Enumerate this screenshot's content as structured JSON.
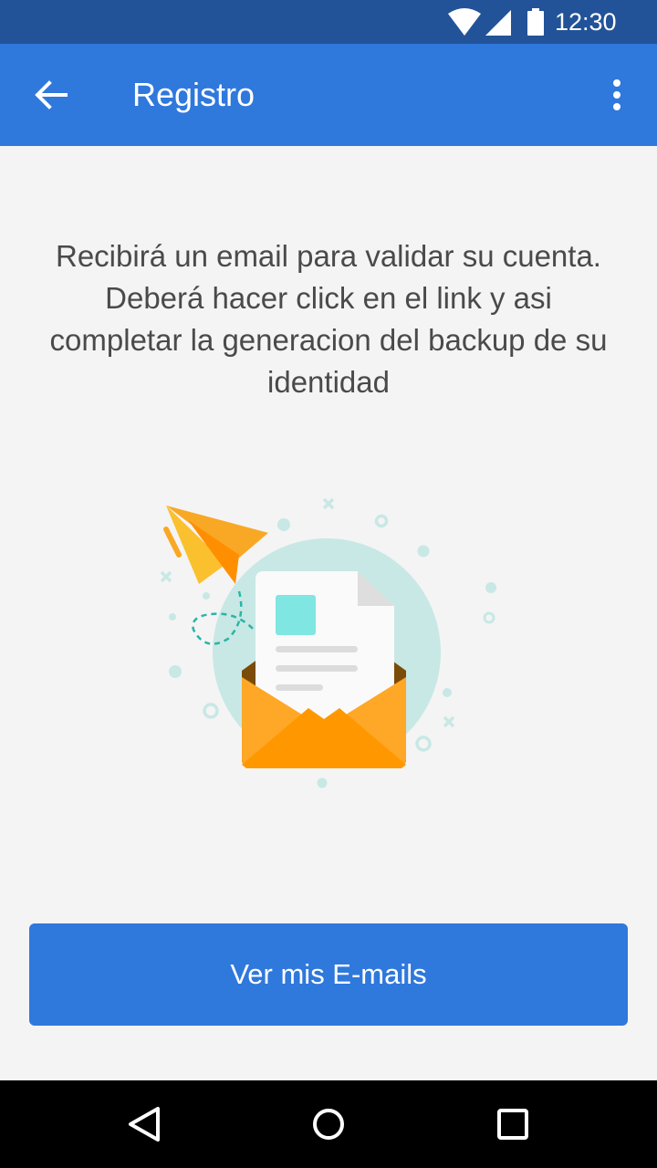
{
  "status_bar": {
    "time": "12:30",
    "icons": [
      "wifi-icon",
      "cellular-signal-icon",
      "battery-icon"
    ]
  },
  "app_bar": {
    "title": "Registro",
    "back_icon": "arrow-back-icon",
    "menu_icon": "more-vert-icon"
  },
  "main": {
    "message": "Recibirá un email para validar su cuenta. Deberá hacer click en el link y asi completar la generacion del backup de su identidad",
    "illustration": "email-envelope-illustration",
    "button_label": "Ver mis E-mails"
  },
  "nav_bar": {
    "icons": [
      "nav-back-icon",
      "nav-home-icon",
      "nav-recents-icon"
    ]
  },
  "colors": {
    "status_bar": "#225398",
    "primary": "#2f78dc",
    "background": "#f4f4f4",
    "text": "#4a4a4a"
  }
}
